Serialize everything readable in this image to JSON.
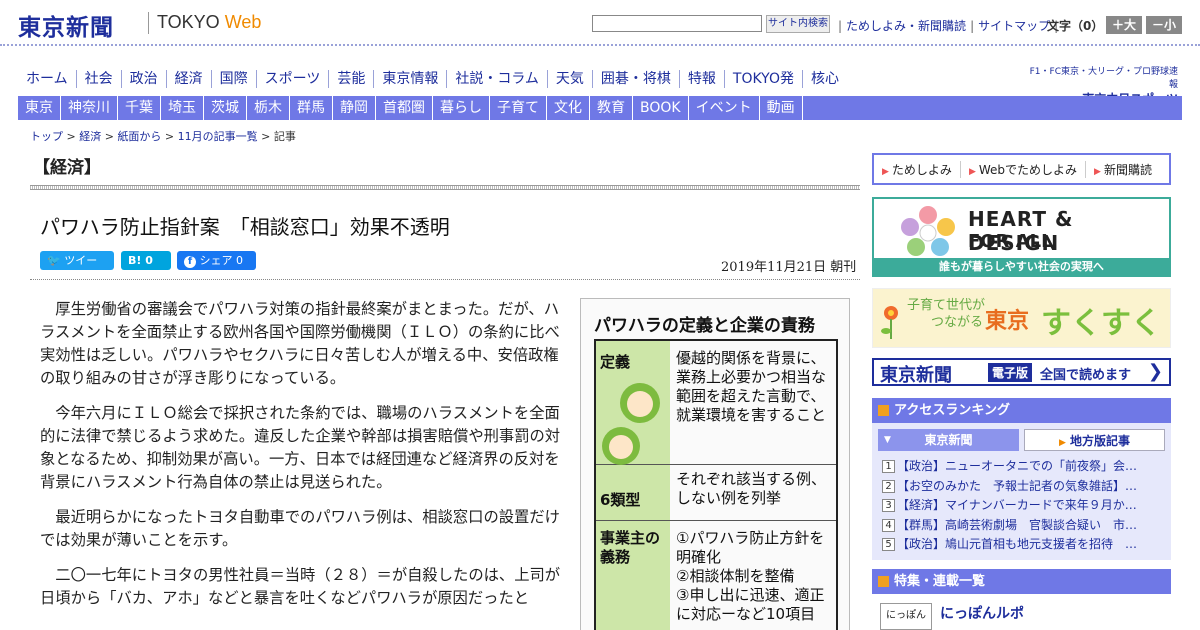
{
  "header": {
    "logo_jp": "東京新聞",
    "logo_en_tokyo": "TOKYO",
    "logo_en_web": "Web",
    "search_placeholder": "",
    "search_button": "サイト内検索",
    "link_trial": "ためしよみ・新聞購読",
    "link_sitemap": "サイトマップ",
    "font_size_label": "文字（0）",
    "font_bigger": "＋大",
    "font_smaller": "－小"
  },
  "nav_primary": [
    "ホーム",
    "社会",
    "政治",
    "経済",
    "国際",
    "スポーツ",
    "芸能",
    "東京情報",
    "社説・コラム",
    "天気",
    "囲碁・将棋",
    "特報",
    "TOKYO発",
    "核心"
  ],
  "chunichi_sports": {
    "line1": "F1・FC東京・大リーグ・プロ野球速報",
    "line2": "東京中日スポーツ"
  },
  "nav_regional": [
    "東京",
    "神奈川",
    "千葉",
    "埼玉",
    "茨城",
    "栃木",
    "群馬",
    "静岡",
    "首都圏",
    "暮らし",
    "子育て",
    "文化",
    "教育",
    "BOOK",
    "イベント",
    "動画"
  ],
  "breadcrumb": {
    "top": "トップ",
    "economy": "経済",
    "paper": "紙面から",
    "list": "11月の記事一覧",
    "current": "記事"
  },
  "section_title": "【経済】",
  "article": {
    "headline": "パワハラ防止指針案　「相談窓口」効果不透明",
    "share_tweet": "ツイート",
    "share_hatena": "B! 0",
    "share_facebook": "シェア 0",
    "date": "2019年11月21日 朝刊",
    "paragraphs": [
      "厚生労働省の審議会でパワハラ対策の指針最終案がまとまった。だが、ハラスメントを全面禁止する欧州各国や国際労働機関（ＩＬＯ）の条約に比べ実効性は乏しい。パワハラやセクハラに日々苦しむ人が増える中、安倍政権の取り組みの甘さが浮き彫りになっている。",
      "今年六月にＩＬＯ総会で採択された条約では、職場のハラスメントを全面的に法律で禁じるよう求めた。違反した企業や幹部は損害賠償や刑事罰の対象となるため、抑制効果が高い。一方、日本では経団連など経済界の反対を背景にハラスメント行為自体の禁止は見送られた。",
      "最近明らかになったトヨタ自動車でのパワハラ例は、相談窓口の設置だけでは効果が薄いことを示す。",
      "二〇一七年にトヨタの男性社員＝当時（２８）＝が自殺したのは、上司が日頃から「バカ、アホ」などと暴言を吐くなどパワハラが原因だったと"
    ]
  },
  "figure": {
    "title": "パワハラの定義と企業の責務",
    "row1_label": "定義",
    "row1_text": "優越的関係を背景に、業務上必要かつ相当な範囲を超えた言動で、就業環境を害すること",
    "row2_label": "6類型",
    "row2_text": "それぞれ該当する例、しない例を列挙",
    "row3_label": "事業主の義務",
    "row3_items": [
      "①パワハラ防止方針を明確化",
      "②相談体制を整備",
      "③申し出に迅速、適正に対応ーなど10項目"
    ]
  },
  "sidebar": {
    "tab_trial": "ためしよみ",
    "tab_web_trial": "Webでためしよみ",
    "tab_subscribe": "新聞購読",
    "hd_line1": "HEART & DESIGN",
    "hd_line2": "FOR ALL",
    "hd_bar": "誰もが暮らしやすい社会の実現へ",
    "sk_small1": "子育て世代が",
    "sk_small2": "つながる",
    "sk_big1": "東京",
    "sk_big2": "すくすく",
    "ep_name": "東京新聞",
    "ep_badge": "電子版",
    "ep_right": "全国で読めます",
    "ranking_title": "アクセスランキング",
    "ranking_tab_a": "東京新聞",
    "ranking_tab_b": "地方版記事",
    "ranking": [
      {
        "num": "1",
        "text": "【政治】ニューオータニでの「前夜祭」会…"
      },
      {
        "num": "2",
        "text": "【お空のみかた　予報士記者の気象雑話】…"
      },
      {
        "num": "3",
        "text": "【経済】マイナンバーカードで来年９月か…"
      },
      {
        "num": "4",
        "text": "【群馬】高崎芸術劇場　官製談合疑い　市…"
      },
      {
        "num": "5",
        "text": "【政治】鳩山元首相も地元支援者を招待　…"
      }
    ],
    "features_title": "特集・連載一覧",
    "features_first_badge": "にっぽん",
    "features_first": "にっぽんルポ"
  }
}
